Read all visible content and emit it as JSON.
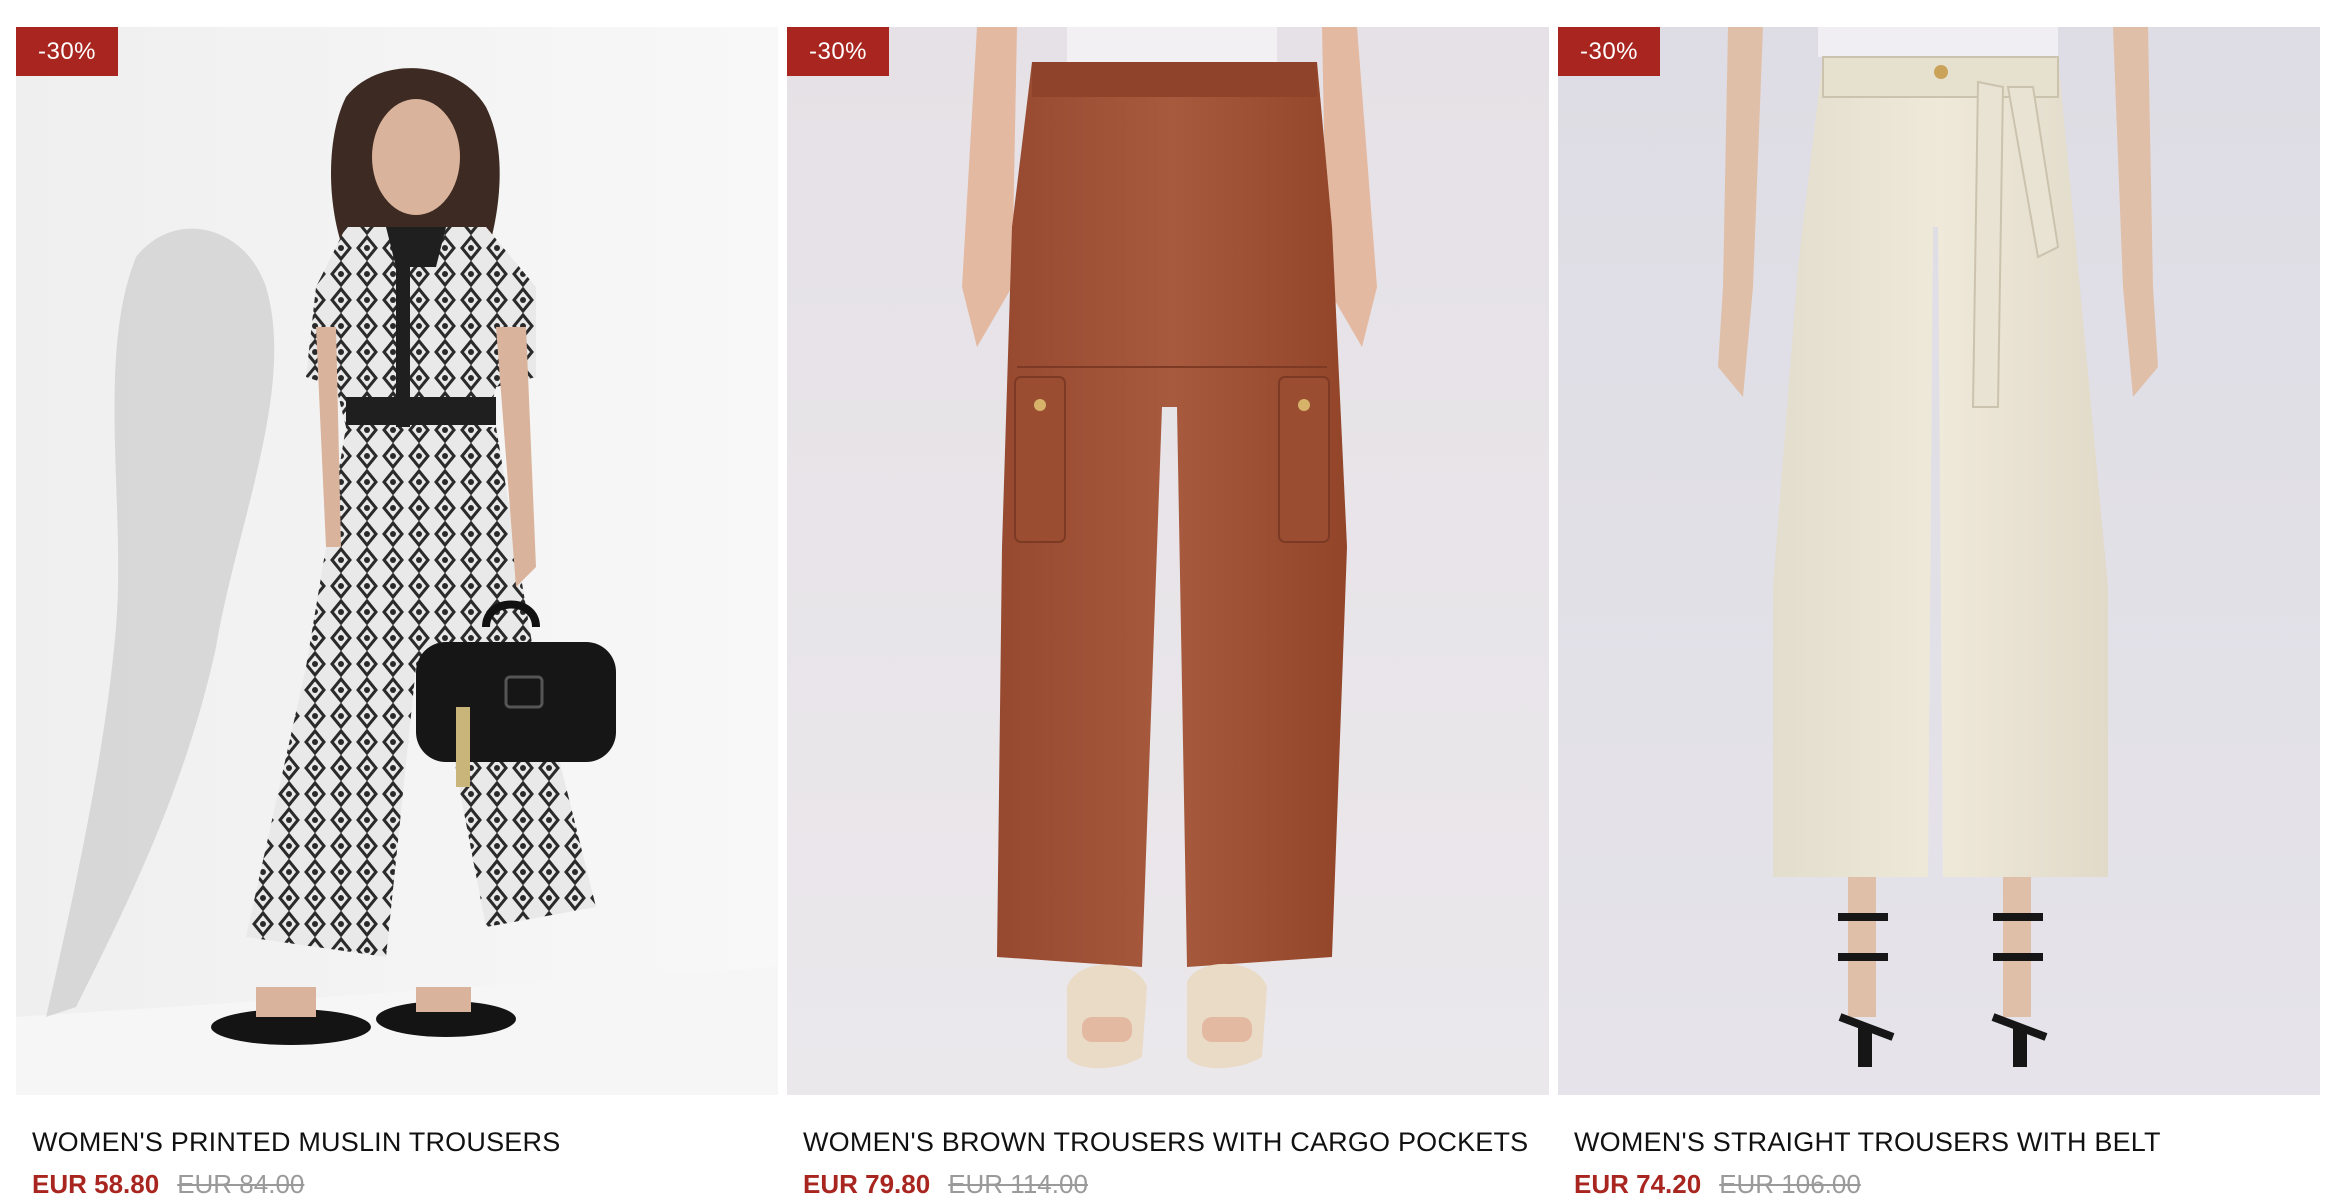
{
  "colors": {
    "sale": "#a8261f",
    "badge_bg": "#a8261f",
    "old_price": "#9a9a9a"
  },
  "products": [
    {
      "badge": "-30%",
      "title": "WOMEN'S PRINTED MUSLIN TROUSERS",
      "sale_price": "EUR 58.80",
      "old_price": "EUR 84.00",
      "image_alt": "Model wearing black and white printed muslin trousers with a black handbag"
    },
    {
      "badge": "-30%",
      "title": "WOMEN'S BROWN TROUSERS WITH CARGO POCKETS",
      "sale_price": "EUR 79.80",
      "old_price": "EUR 114.00",
      "image_alt": "Brown cargo trousers with side pockets"
    },
    {
      "badge": "-30%",
      "title": "WOMEN'S STRAIGHT TROUSERS WITH BELT",
      "sale_price": "EUR 74.20",
      "old_price": "EUR 106.00",
      "image_alt": "Cream straight trousers with tie belt and black heels"
    }
  ]
}
